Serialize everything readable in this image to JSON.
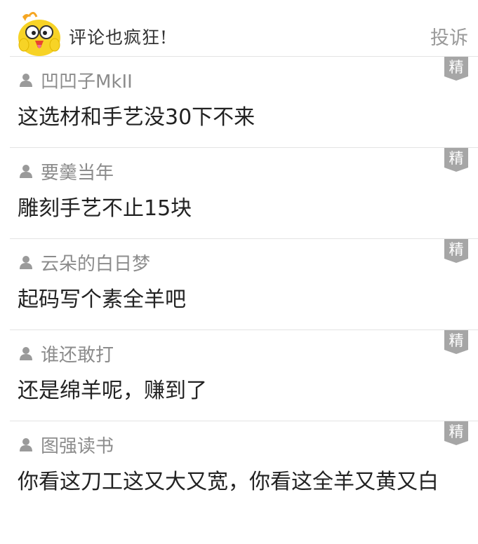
{
  "header": {
    "title": "评论也疯狂!",
    "report_label": "投诉",
    "mascot": "yellow-chick-mascot"
  },
  "badge_label": "精",
  "colors": {
    "badge_bg": "#a6a6a6",
    "username": "#8c8c8c",
    "comment_text": "#222222",
    "divider": "#e3e3e3",
    "mascot_yellow": "#f7d326"
  },
  "comments": [
    {
      "user": "凹凹子MkII",
      "text": "这选材和手艺没30下不来"
    },
    {
      "user": "要羹当年",
      "text": "雕刻手艺不止15块"
    },
    {
      "user": "云朵的白日梦",
      "text": "起码写个素全羊吧"
    },
    {
      "user": "谁还敢打",
      "text": "还是绵羊呢，赚到了"
    },
    {
      "user": "图强读书",
      "text": "你看这刀工这又大又宽，你看这全羊又黄又白"
    }
  ]
}
